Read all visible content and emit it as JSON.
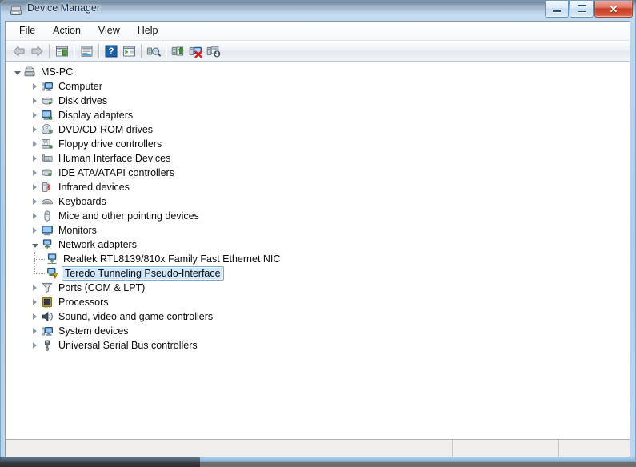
{
  "window": {
    "title": "Device Manager",
    "title_icon": "device-manager-icon",
    "controls": {
      "minimize_label": "–",
      "maximize_label": "□",
      "close_label": "✕"
    }
  },
  "menubar": {
    "items": [
      {
        "label": "File",
        "name": "menu-file"
      },
      {
        "label": "Action",
        "name": "menu-action"
      },
      {
        "label": "View",
        "name": "menu-view"
      },
      {
        "label": "Help",
        "name": "menu-help"
      }
    ]
  },
  "toolbar": {
    "buttons": [
      {
        "name": "back-button",
        "icon": "back-arrow-icon"
      },
      {
        "name": "forward-button",
        "icon": "forward-arrow-icon"
      },
      {
        "name": "show-hide-console-tree-button",
        "icon": "console-tree-icon"
      },
      {
        "name": "properties-button",
        "icon": "properties-icon"
      },
      {
        "name": "help-button",
        "icon": "help-question-icon"
      },
      {
        "name": "show-hide-action-pane-button",
        "icon": "action-pane-icon"
      },
      {
        "name": "scan-for-hardware-changes-button",
        "icon": "scan-hardware-icon"
      },
      {
        "name": "update-driver-software-button",
        "icon": "update-driver-icon"
      },
      {
        "name": "uninstall-device-button",
        "icon": "uninstall-device-icon"
      },
      {
        "name": "disable-device-button",
        "icon": "disable-device-icon"
      }
    ]
  },
  "tree": {
    "root": {
      "label": "MS-PC",
      "icon": "computer-root-icon",
      "expanded": true,
      "selected": false
    },
    "items": [
      {
        "label": "Computer",
        "icon": "computer-icon",
        "expanded": false,
        "selected": false,
        "level": 1
      },
      {
        "label": "Disk drives",
        "icon": "disk-drive-icon",
        "expanded": false,
        "selected": false,
        "level": 1
      },
      {
        "label": "Display adapters",
        "icon": "display-adapter-icon",
        "expanded": false,
        "selected": false,
        "level": 1
      },
      {
        "label": "DVD/CD-ROM drives",
        "icon": "dvd-cdrom-icon",
        "expanded": false,
        "selected": false,
        "level": 1
      },
      {
        "label": "Floppy drive controllers",
        "icon": "floppy-controller-icon",
        "expanded": false,
        "selected": false,
        "level": 1
      },
      {
        "label": "Human Interface Devices",
        "icon": "hid-icon",
        "expanded": false,
        "selected": false,
        "level": 1
      },
      {
        "label": "IDE ATA/ATAPI controllers",
        "icon": "ide-controller-icon",
        "expanded": false,
        "selected": false,
        "level": 1
      },
      {
        "label": "Infrared devices",
        "icon": "infrared-icon",
        "expanded": false,
        "selected": false,
        "level": 1
      },
      {
        "label": "Keyboards",
        "icon": "keyboard-icon",
        "expanded": false,
        "selected": false,
        "level": 1
      },
      {
        "label": "Mice and other pointing devices",
        "icon": "mouse-icon",
        "expanded": false,
        "selected": false,
        "level": 1
      },
      {
        "label": "Monitors",
        "icon": "monitor-icon",
        "expanded": false,
        "selected": false,
        "level": 1
      },
      {
        "label": "Network adapters",
        "icon": "network-adapter-icon",
        "expanded": true,
        "selected": false,
        "level": 1
      },
      {
        "label": "Realtek RTL8139/810x Family Fast Ethernet NIC",
        "icon": "network-adapter-icon",
        "expanded": null,
        "selected": false,
        "level": 2
      },
      {
        "label": "Teredo Tunneling Pseudo-Interface",
        "icon": "network-adapter-warning-icon",
        "expanded": null,
        "selected": true,
        "level": 2
      },
      {
        "label": "Ports (COM & LPT)",
        "icon": "port-icon",
        "expanded": false,
        "selected": false,
        "level": 1
      },
      {
        "label": "Processors",
        "icon": "processor-icon",
        "expanded": false,
        "selected": false,
        "level": 1
      },
      {
        "label": "Sound, video and game controllers",
        "icon": "sound-icon",
        "expanded": false,
        "selected": false,
        "level": 1
      },
      {
        "label": "System devices",
        "icon": "system-device-icon",
        "expanded": false,
        "selected": false,
        "level": 1
      },
      {
        "label": "Universal Serial Bus controllers",
        "icon": "usb-controller-icon",
        "expanded": false,
        "selected": false,
        "level": 1
      }
    ]
  },
  "statusbar": {
    "cells": [
      "",
      "",
      ""
    ]
  },
  "colors": {
    "selection_fill": "#cfe6fb",
    "selection_border": "#7fa8ce",
    "warning_yellow": "#ffd42a",
    "frame_blue": "#aecded",
    "close_red": "#c63d24",
    "client_bg": "#ffffff",
    "statusbar_bg": "#f1eeee"
  }
}
